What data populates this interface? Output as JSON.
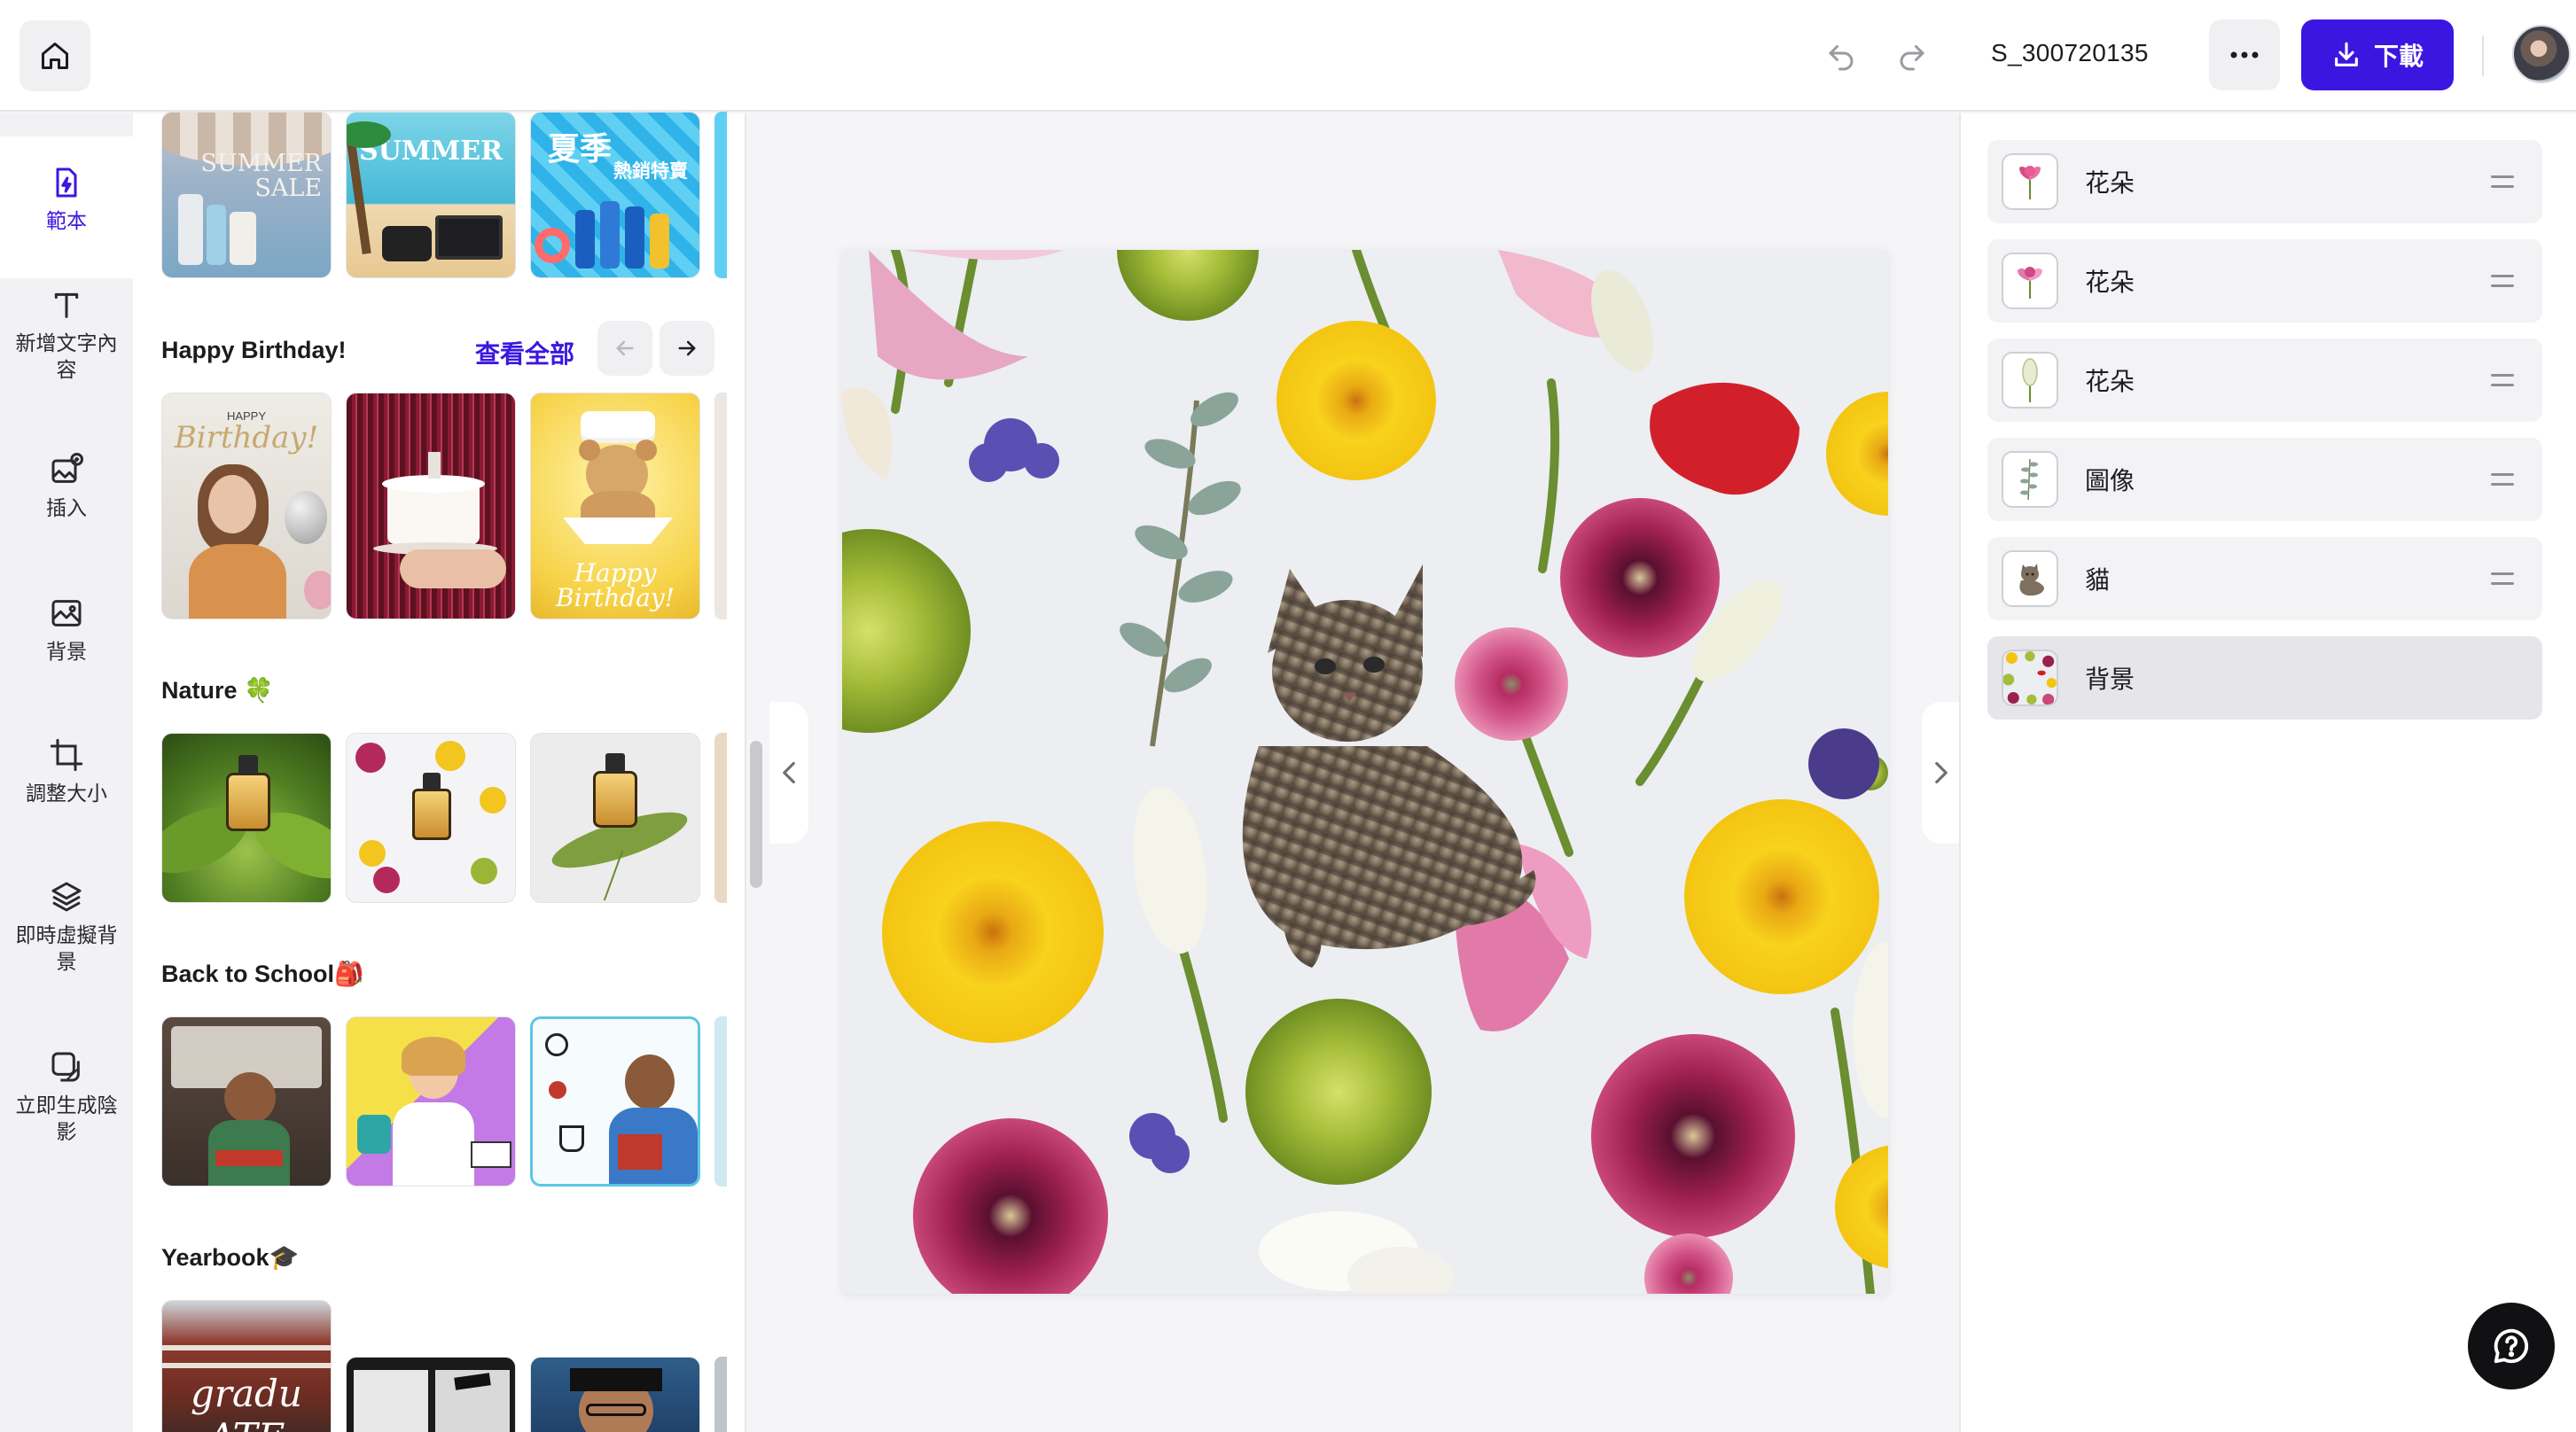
{
  "header": {
    "doc_name": "S_300720135",
    "download_label": "下載",
    "icons": [
      "home-icon",
      "undo-icon",
      "redo-icon",
      "more-icon",
      "download-icon"
    ]
  },
  "rail": {
    "items": [
      {
        "label": "範本",
        "icon": "template-icon",
        "active": true
      },
      {
        "label": "新增文字內容",
        "icon": "text-icon"
      },
      {
        "label": "插入",
        "icon": "insert-image-icon"
      },
      {
        "label": "背景",
        "icon": "background-icon"
      },
      {
        "label": "調整大小",
        "icon": "crop-icon"
      },
      {
        "label": "即時虛擬背景",
        "icon": "layers-icon"
      },
      {
        "label": "立即生成陰影",
        "icon": "shadow-icon"
      }
    ]
  },
  "templates": {
    "see_all": "查看全部",
    "sections": [
      {
        "title": "Happy Birthday!"
      },
      {
        "title": "Nature 🍀"
      },
      {
        "title": "Back to School🎒"
      },
      {
        "title": "Yearbook🎓"
      }
    ],
    "thumb_text": {
      "summer_sale_1": "SUMMER",
      "summer_sale_2": "SALE",
      "summer_2": "SUMMER",
      "summer_cn_1": "夏季",
      "summer_cn_2": "熱銷特賣",
      "birthday_small": "HAPPY",
      "birthday_script": "Birthday!",
      "bear_1": "Happy",
      "bear_2": "Birthday!",
      "yearbook": "gradu ATE"
    }
  },
  "layers": {
    "items": [
      {
        "name": "花朵",
        "thumb": "pink-flower"
      },
      {
        "name": "花朵",
        "thumb": "pink-flower"
      },
      {
        "name": "花朵",
        "thumb": "white-bud"
      },
      {
        "name": "圖像",
        "thumb": "eucalyptus-sprig"
      },
      {
        "name": "貓",
        "thumb": "cat"
      },
      {
        "name": "背景",
        "thumb": "floral-background",
        "selected": true
      }
    ]
  },
  "colors": {
    "accent": "#3b16e0",
    "panel_bg": "#ffffff",
    "rail_bg": "#f2f2f5",
    "canvas_bg": "#f5f5f7"
  }
}
